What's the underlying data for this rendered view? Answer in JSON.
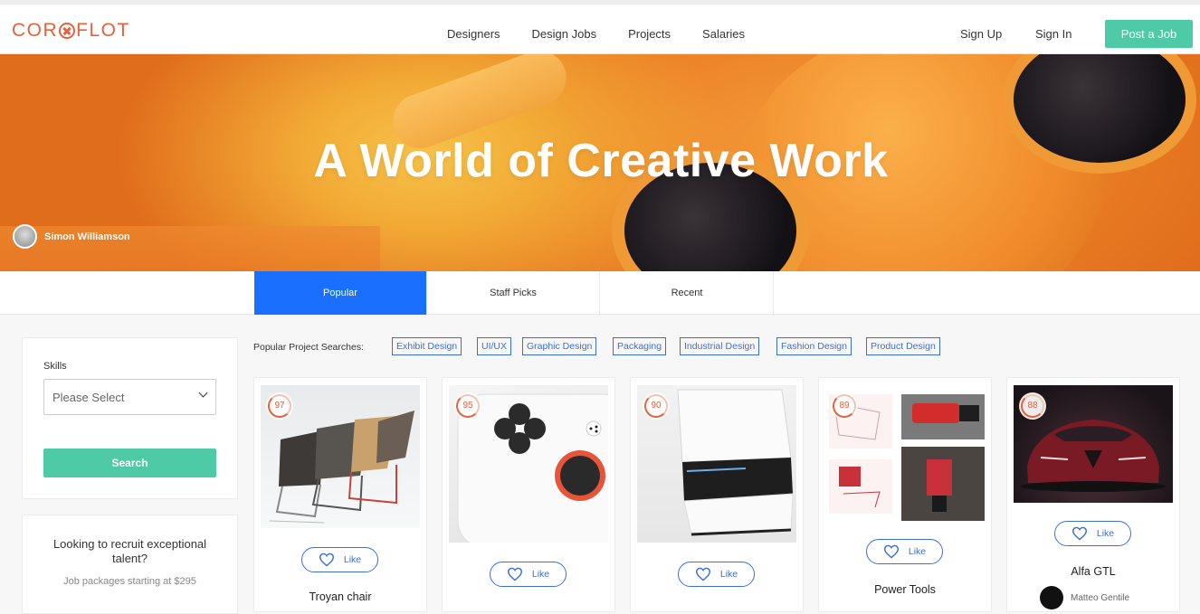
{
  "brand": {
    "logo_left": "COR",
    "logo_right": "FLOT"
  },
  "nav": {
    "items": [
      "Designers",
      "Design Jobs",
      "Projects",
      "Salaries"
    ]
  },
  "auth": {
    "signup": "Sign Up",
    "signin": "Sign In",
    "post_job": "Post a Job"
  },
  "hero": {
    "title": "A World of Creative Work",
    "credit_name": "Simon Williamson"
  },
  "tabs": [
    "Popular",
    "Staff Picks",
    "Recent"
  ],
  "sidebar": {
    "skills_label": "Skills",
    "select_placeholder": "Please Select",
    "search_button": "Search",
    "recruit_title": "Looking to recruit exceptional talent?",
    "recruit_sub": "Job packages starting at $295"
  },
  "popular_searches": {
    "label": "Popular Project Searches:",
    "tags": [
      "Exhibit Design",
      "UI/UX",
      "Graphic Design",
      "Packaging",
      "Industrial Design",
      "Fashion Design",
      "Product Design"
    ]
  },
  "projects": [
    {
      "score": "97",
      "like": "Like",
      "title": "Troyan chair"
    },
    {
      "score": "95",
      "like": "Like",
      "title": ""
    },
    {
      "score": "90",
      "like": "Like",
      "title": ""
    },
    {
      "score": "89",
      "like": "Like",
      "title": "Power Tools"
    },
    {
      "score": "88",
      "like": "Like",
      "title": "Alfa GTL",
      "owner": "Matteo Gentile"
    }
  ],
  "colors": {
    "accent_green": "#4ecba6",
    "tab_blue": "#1a6fff",
    "brand_orange": "#e8603c",
    "tag_blue": "#3a6fd8"
  }
}
